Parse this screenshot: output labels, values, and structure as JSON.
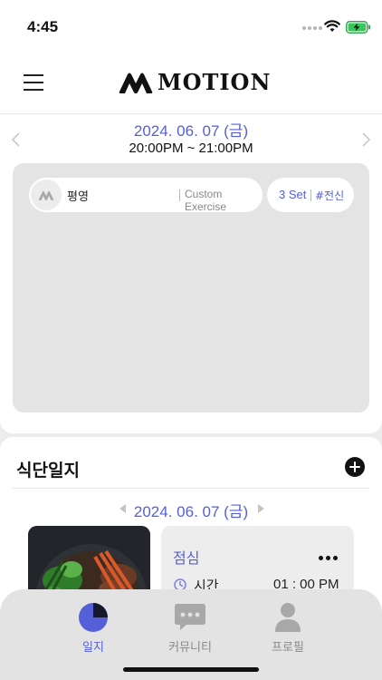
{
  "status_bar": {
    "time": "4:45"
  },
  "header": {
    "logo_text": "MOTION",
    "menu_icon": "hamburger-icon"
  },
  "workout": {
    "date": "2024. 06. 07 (금)",
    "time_range": "20:00PM ~ 21:00PM",
    "exercise": {
      "name": "평영",
      "category": "Custom Exercise",
      "sets": "3 Set",
      "tag": "#전신"
    }
  },
  "diet": {
    "title": "식단일지",
    "date": "2024. 06. 07 (금)",
    "meal": {
      "name": "점심",
      "time_label": "시간",
      "time_value": "01 : 00 PM"
    }
  },
  "tabs": [
    {
      "label": "일지",
      "icon": "pie-chart-icon",
      "active": true
    },
    {
      "label": "커뮤니티",
      "icon": "chat-icon",
      "active": false
    },
    {
      "label": "프로필",
      "icon": "person-icon",
      "active": false
    }
  ],
  "colors": {
    "accent": "#5560d8",
    "panel": "#e4e4e4",
    "tabbar": "#e3e3e3"
  }
}
